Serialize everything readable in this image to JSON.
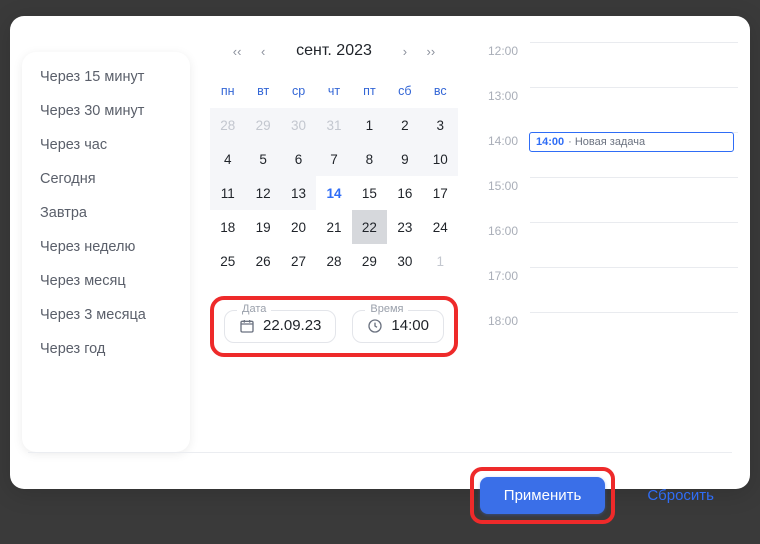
{
  "presets": [
    "Через 15 минут",
    "Через 30 минут",
    "Через час",
    "Сегодня",
    "Завтра",
    "Через неделю",
    "Через месяц",
    "Через 3 месяца",
    "Через год"
  ],
  "calendar": {
    "title": "сент.  2023",
    "weekdays": [
      "пн",
      "вт",
      "ср",
      "чт",
      "пт",
      "сб",
      "вс"
    ],
    "days": [
      {
        "n": "28",
        "muted": true,
        "bg": true
      },
      {
        "n": "29",
        "muted": true,
        "bg": true
      },
      {
        "n": "30",
        "muted": true,
        "bg": true
      },
      {
        "n": "31",
        "muted": true,
        "bg": true
      },
      {
        "n": "1",
        "bg": true
      },
      {
        "n": "2",
        "bg": true
      },
      {
        "n": "3",
        "bg": true
      },
      {
        "n": "4",
        "bg": true
      },
      {
        "n": "5",
        "bg": true
      },
      {
        "n": "6",
        "bg": true
      },
      {
        "n": "7",
        "bg": true
      },
      {
        "n": "8",
        "bg": true
      },
      {
        "n": "9",
        "bg": true
      },
      {
        "n": "10",
        "bg": true
      },
      {
        "n": "11",
        "bg": true
      },
      {
        "n": "12",
        "bg": true
      },
      {
        "n": "13",
        "bg": true
      },
      {
        "n": "14",
        "today": true
      },
      {
        "n": "15"
      },
      {
        "n": "16"
      },
      {
        "n": "17"
      },
      {
        "n": "18"
      },
      {
        "n": "19"
      },
      {
        "n": "20"
      },
      {
        "n": "21"
      },
      {
        "n": "22",
        "selected": true
      },
      {
        "n": "23"
      },
      {
        "n": "24"
      },
      {
        "n": "25"
      },
      {
        "n": "26"
      },
      {
        "n": "27"
      },
      {
        "n": "28"
      },
      {
        "n": "29"
      },
      {
        "n": "30"
      },
      {
        "n": "1",
        "muted": true
      }
    ]
  },
  "fields": {
    "date_label": "Дата",
    "date_value": "22.09.23",
    "time_label": "Время",
    "time_value": "14:00"
  },
  "timeline": {
    "hours": [
      "12:00",
      "13:00",
      "14:00",
      "15:00",
      "16:00",
      "17:00",
      "18:00"
    ],
    "event": {
      "hour": "14:00",
      "time": "14:00",
      "title": "· Новая задача"
    }
  },
  "footer": {
    "apply": "Применить",
    "reset": "Сбросить"
  }
}
